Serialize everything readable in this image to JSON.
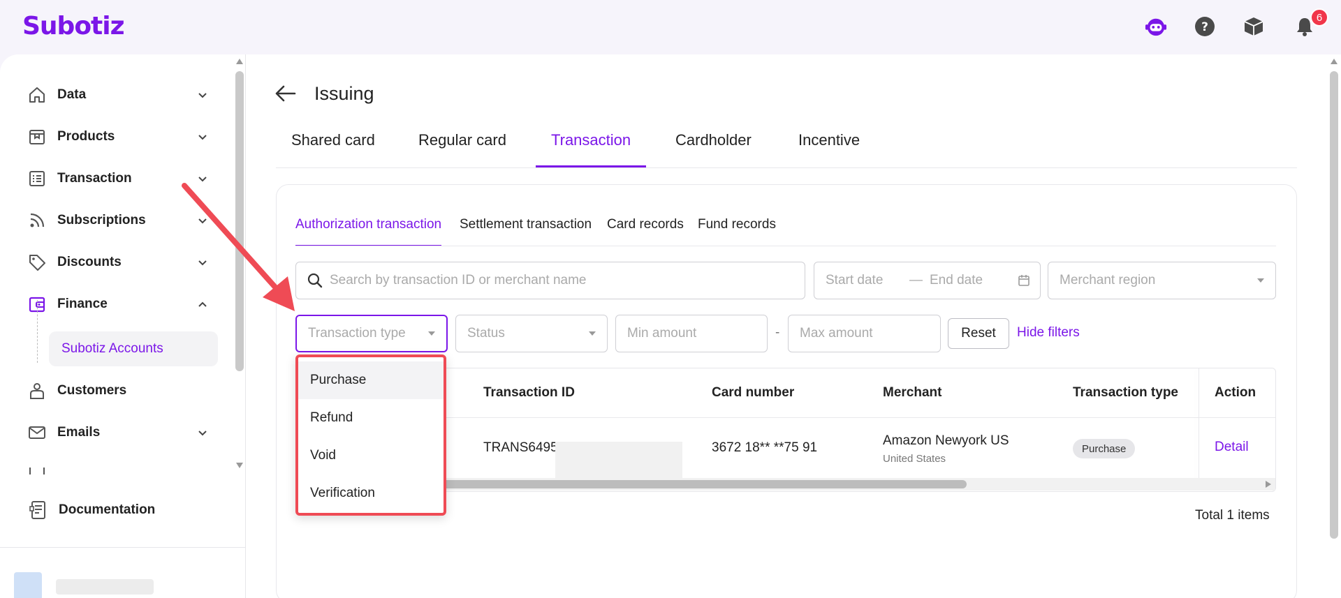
{
  "app": {
    "brand": "Subotiz",
    "notification_count": "6",
    "accent": "#7b16e8"
  },
  "header_icons": [
    "bot-icon",
    "help-icon",
    "box-icon",
    "bell-icon"
  ],
  "sidebar": {
    "items": [
      {
        "label": "Data",
        "icon": "home-icon",
        "expanded": false
      },
      {
        "label": "Products",
        "icon": "product-icon",
        "expanded": false
      },
      {
        "label": "Transaction",
        "icon": "list-icon",
        "expanded": false
      },
      {
        "label": "Subscriptions",
        "icon": "rss-icon",
        "expanded": false
      },
      {
        "label": "Discounts",
        "icon": "tag-icon",
        "expanded": false
      },
      {
        "label": "Finance",
        "icon": "wallet-icon",
        "expanded": true
      },
      {
        "label": "Customers",
        "icon": "person-icon",
        "expanded": false
      },
      {
        "label": "Emails",
        "icon": "mail-icon",
        "expanded": false
      }
    ],
    "sub_items": [
      {
        "label": "Subotiz Accounts"
      }
    ],
    "footer": {
      "label": "Documentation"
    }
  },
  "page": {
    "title": "Issuing"
  },
  "tabs": [
    {
      "label": "Shared card",
      "active": false
    },
    {
      "label": "Regular card",
      "active": false
    },
    {
      "label": "Transaction",
      "active": true
    },
    {
      "label": "Cardholder",
      "active": false
    },
    {
      "label": "Incentive",
      "active": false
    }
  ],
  "subtabs": [
    {
      "label": "Authorization transaction",
      "active": true
    },
    {
      "label": "Settlement transaction",
      "active": false
    },
    {
      "label": "Card records",
      "active": false
    },
    {
      "label": "Fund records",
      "active": false
    }
  ],
  "filters": {
    "search_placeholder": "Search by transaction ID or merchant name",
    "start_date": "Start date",
    "date_separator": "—",
    "end_date": "End date",
    "merchant_region": "Merchant region",
    "transaction_type": "Transaction type",
    "status": "Status",
    "min_amount": "Min amount",
    "range_separator": "-",
    "max_amount": "Max amount",
    "reset": "Reset",
    "hide_filters": "Hide filters"
  },
  "dropdown": {
    "options": [
      "Purchase",
      "Refund",
      "Void",
      "Verification"
    ],
    "highlighted": "Purchase"
  },
  "table": {
    "columns": [
      "Transaction ID",
      "Card number",
      "Merchant",
      "Transaction type",
      "Action"
    ],
    "rows": [
      {
        "transaction_id": "TRANS6495",
        "card_number": "3672 18** **75 91",
        "merchant": "Amazon Newyork US",
        "merchant_region": "United States",
        "transaction_type": "Purchase",
        "action": "Detail"
      }
    ],
    "total": "Total 1 items"
  }
}
